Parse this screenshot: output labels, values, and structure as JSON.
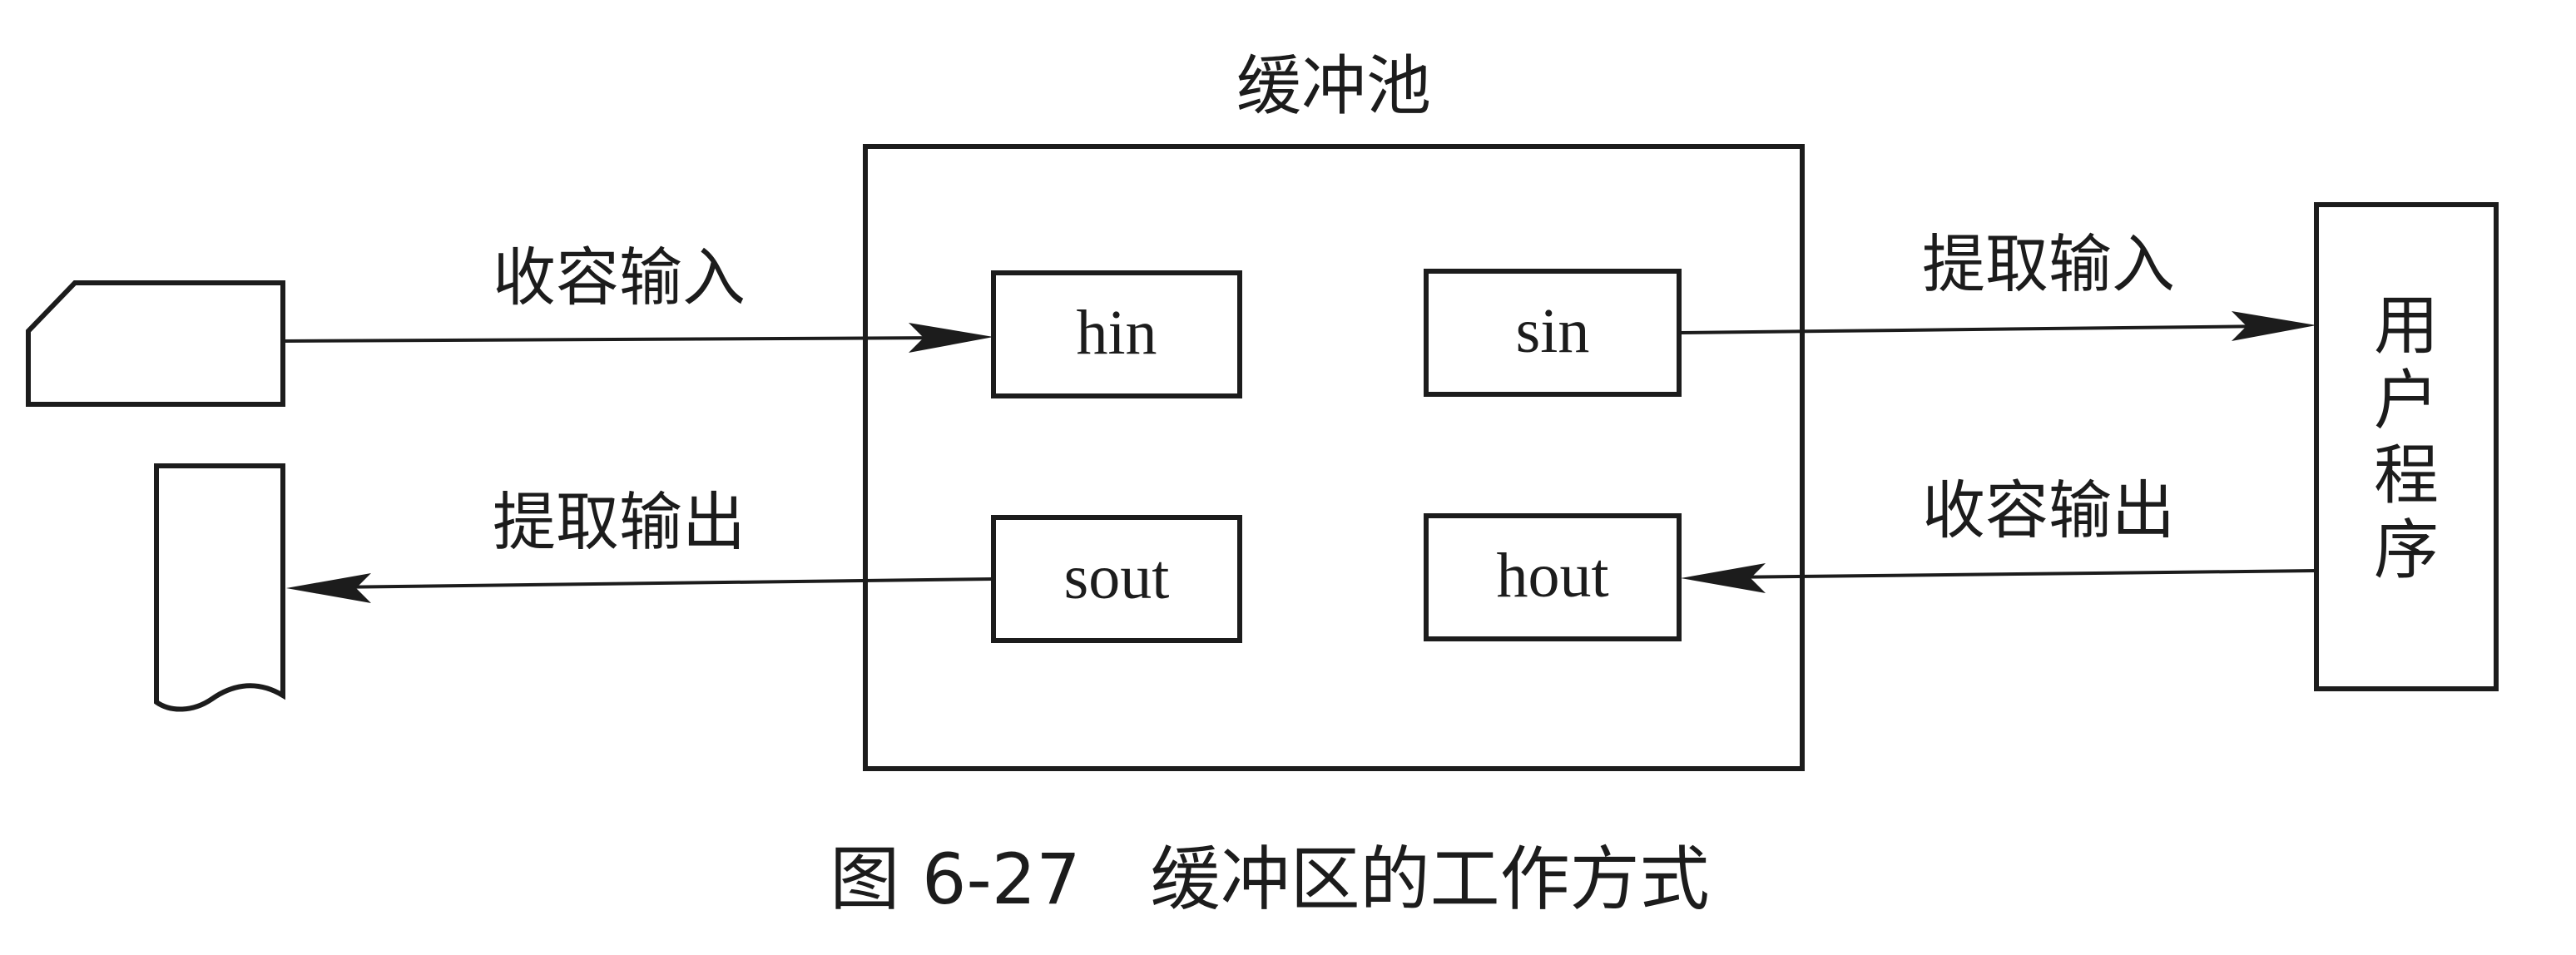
{
  "diagram": {
    "pool_title": "缓冲池",
    "buffers": {
      "hin": "hin",
      "sin": "sin",
      "sout": "sout",
      "hout": "hout"
    },
    "edges": {
      "collect_input": "收容输入",
      "extract_output": "提取输出",
      "extract_input": "提取输入",
      "collect_output": "收容输出"
    },
    "user_program": [
      "用",
      "户",
      "程",
      "序"
    ]
  },
  "caption": "图 6-27　缓冲区的工作方式",
  "colors": {
    "ink": "#1c1c1c",
    "paper": "#ffffff"
  }
}
